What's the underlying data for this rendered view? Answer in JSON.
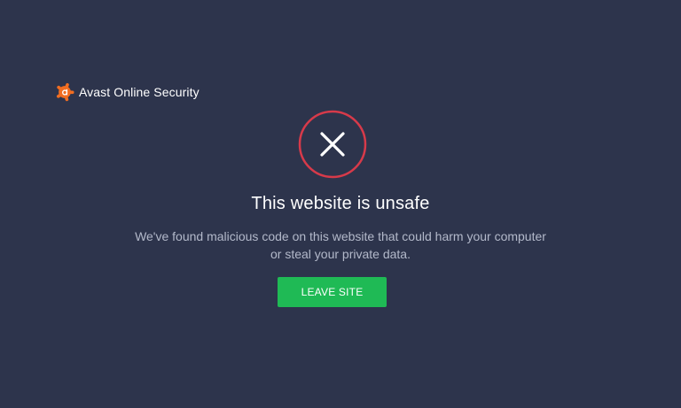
{
  "brand": {
    "name": "Avast Online Security",
    "logo_color": "#f16d21"
  },
  "alert": {
    "icon": "close-icon",
    "ring_color": "#d73a4a",
    "title": "This website is unsafe",
    "message": "We've found malicious code on this website that could harm your computer or steal your private data."
  },
  "actions": {
    "leave_label": "LEAVE SITE",
    "leave_color": "#1fba55"
  },
  "colors": {
    "background": "#2d344c",
    "text": "#ffffff",
    "muted_text": "#b3b9ca"
  }
}
